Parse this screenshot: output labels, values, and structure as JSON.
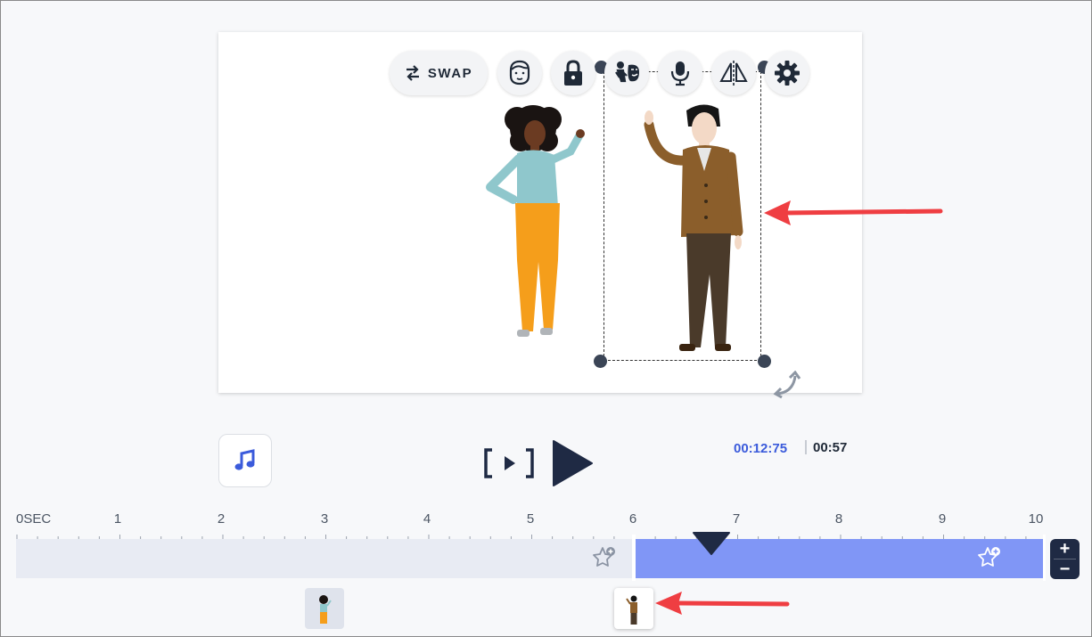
{
  "toolbar": {
    "swap_label": "SWAP"
  },
  "playback": {
    "current_time": "00:12:75",
    "total_time": "00:57"
  },
  "timeline": {
    "tick_labels": [
      "0SEC",
      "1",
      "2",
      "3",
      "4",
      "5",
      "6",
      "7",
      "8",
      "9",
      "10"
    ],
    "zoom_in_label": "+",
    "zoom_out_label": "−"
  },
  "colors": {
    "accent": "#3b5bdb",
    "track_active": "#8096f6",
    "track_inactive": "#e8ebf3",
    "dark": "#1f2a44",
    "arrow": "#ef3e42"
  }
}
